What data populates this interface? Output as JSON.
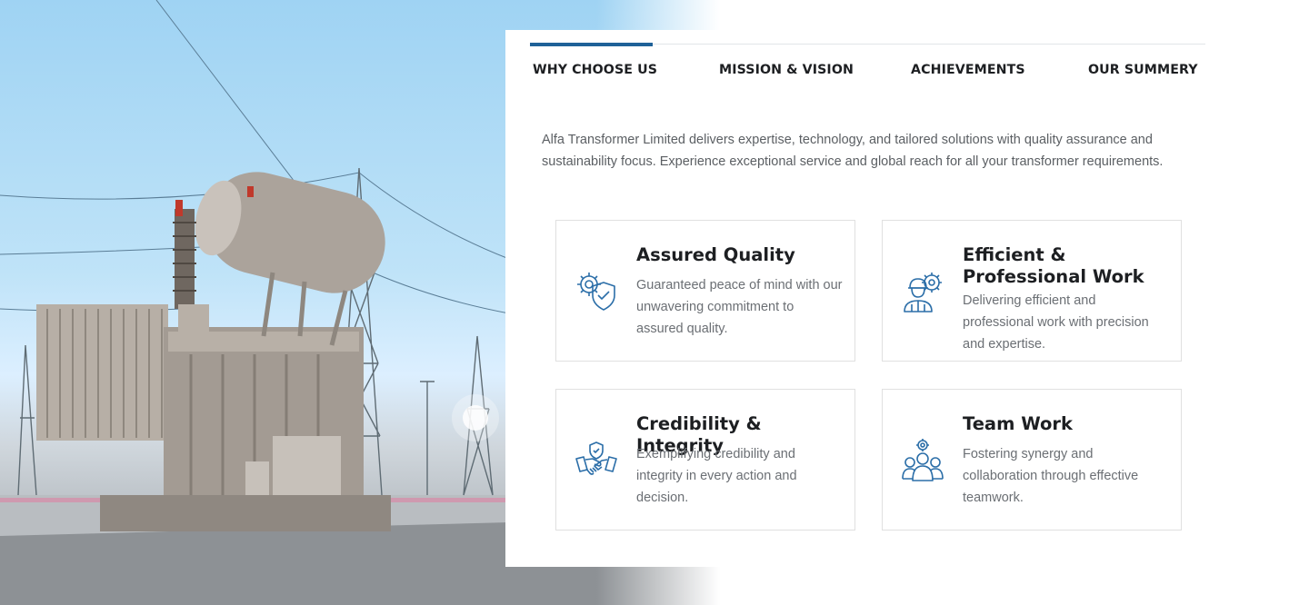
{
  "tabs": [
    {
      "label": "WHY CHOOSE US",
      "active": true
    },
    {
      "label": "MISSION & VISION",
      "active": false
    },
    {
      "label": "ACHIEVEMENTS",
      "active": false
    },
    {
      "label": "OUR SUMMERY",
      "active": false
    }
  ],
  "intro": "Alfa Transformer Limited delivers expertise, technology, and tailored  solutions with quality assurance and sustainability focus. Experience  exceptional service and global reach for all your transformer requirements.",
  "cards": [
    {
      "title": "Assured Quality",
      "text": "Guaranteed peace of mind with our unwavering commitment to assured quality.",
      "icon": "quality-shield-gear-icon"
    },
    {
      "title": "Efficient & Professional Work",
      "text": "Delivering efficient and professional work with precision and expertise.",
      "icon": "engineer-gear-icon"
    },
    {
      "title": "Credibility & Integrity",
      "text": "Exemplifying credibility and integrity in every action and decision.",
      "icon": "handshake-icon"
    },
    {
      "title": "Team Work",
      "text": "Fostering synergy and collaboration through effective teamwork.",
      "icon": "team-group-icon"
    }
  ],
  "colors": {
    "accent": "#1f6198",
    "icon": "#2b6ea8",
    "heading": "#1d1f22",
    "body_text": "#6b6f74"
  }
}
